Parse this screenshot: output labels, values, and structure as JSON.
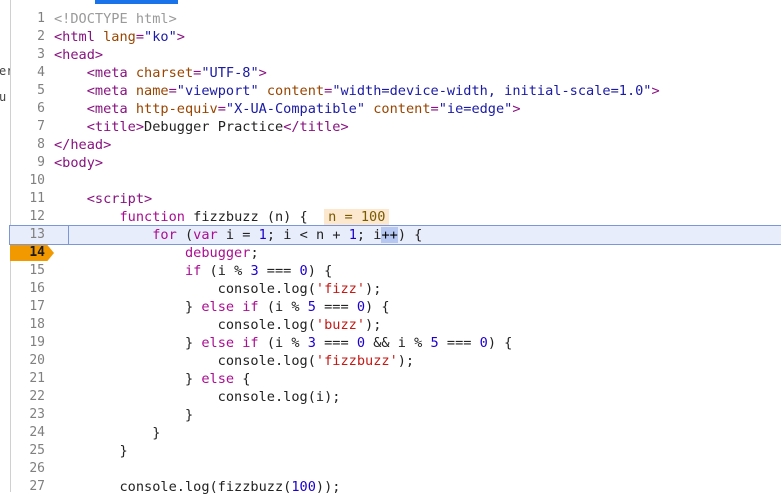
{
  "side_fragments": [
    "er",
    "u"
  ],
  "lines": [
    {
      "n": "1",
      "t": [
        {
          "c": "cmt",
          "v": "<!DOCTYPE html>"
        }
      ]
    },
    {
      "n": "2",
      "t": [
        {
          "c": "tag",
          "v": "<html "
        },
        {
          "c": "attr",
          "v": "lang"
        },
        {
          "c": "tag",
          "v": "="
        },
        {
          "c": "val",
          "v": "\"ko\""
        },
        {
          "c": "tag",
          "v": ">"
        }
      ]
    },
    {
      "n": "3",
      "t": [
        {
          "c": "tag",
          "v": "<head>"
        }
      ]
    },
    {
      "n": "4",
      "t": [
        {
          "c": "txt",
          "v": "    "
        },
        {
          "c": "tag",
          "v": "<meta "
        },
        {
          "c": "attr",
          "v": "charset"
        },
        {
          "c": "tag",
          "v": "="
        },
        {
          "c": "val",
          "v": "\"UTF-8\""
        },
        {
          "c": "tag",
          "v": ">"
        }
      ]
    },
    {
      "n": "5",
      "t": [
        {
          "c": "txt",
          "v": "    "
        },
        {
          "c": "tag",
          "v": "<meta "
        },
        {
          "c": "attr",
          "v": "name"
        },
        {
          "c": "tag",
          "v": "="
        },
        {
          "c": "val",
          "v": "\"viewport\""
        },
        {
          "c": "attr",
          "v": " content"
        },
        {
          "c": "tag",
          "v": "="
        },
        {
          "c": "val",
          "v": "\"width=device-width, initial-scale=1.0\""
        },
        {
          "c": "tag",
          "v": ">"
        }
      ]
    },
    {
      "n": "6",
      "t": [
        {
          "c": "txt",
          "v": "    "
        },
        {
          "c": "tag",
          "v": "<meta "
        },
        {
          "c": "attr",
          "v": "http-equiv"
        },
        {
          "c": "tag",
          "v": "="
        },
        {
          "c": "val",
          "v": "\"X-UA-Compatible\""
        },
        {
          "c": "attr",
          "v": " content"
        },
        {
          "c": "tag",
          "v": "="
        },
        {
          "c": "val",
          "v": "\"ie=edge\""
        },
        {
          "c": "tag",
          "v": ">"
        }
      ]
    },
    {
      "n": "7",
      "t": [
        {
          "c": "txt",
          "v": "    "
        },
        {
          "c": "tag",
          "v": "<title>"
        },
        {
          "c": "txt",
          "v": "Debugger Practice"
        },
        {
          "c": "tag",
          "v": "</title>"
        }
      ]
    },
    {
      "n": "8",
      "t": [
        {
          "c": "tag",
          "v": "</head>"
        }
      ]
    },
    {
      "n": "9",
      "t": [
        {
          "c": "tag",
          "v": "<body>"
        }
      ]
    },
    {
      "n": "10",
      "t": []
    },
    {
      "n": "11",
      "t": [
        {
          "c": "txt",
          "v": "    "
        },
        {
          "c": "tag",
          "v": "<script>"
        }
      ]
    },
    {
      "n": "12",
      "t": [
        {
          "c": "txt",
          "v": "        "
        },
        {
          "c": "kw",
          "v": "function "
        },
        {
          "c": "txt",
          "v": "fizzbuzz (n) {  "
        },
        {
          "c": "inline-val",
          "v": "n = 100"
        }
      ]
    },
    {
      "n": "13",
      "hl": true,
      "t": [
        {
          "c": "txt",
          "v": "            "
        },
        {
          "c": "kw",
          "v": "for "
        },
        {
          "c": "txt",
          "v": "("
        },
        {
          "c": "kw",
          "v": "var "
        },
        {
          "c": "txt",
          "v": "i = "
        },
        {
          "c": "num",
          "v": "1"
        },
        {
          "c": "txt",
          "v": "; i < n + "
        },
        {
          "c": "num",
          "v": "1"
        },
        {
          "c": "txt",
          "v": "; i"
        },
        {
          "c": "sel",
          "v": "++"
        },
        {
          "c": "txt",
          "v": ") {"
        }
      ]
    },
    {
      "n": "14",
      "paused": true,
      "t": [
        {
          "c": "txt",
          "v": "                "
        },
        {
          "c": "kw",
          "v": "debugger"
        },
        {
          "c": "txt",
          "v": ";"
        }
      ]
    },
    {
      "n": "15",
      "t": [
        {
          "c": "txt",
          "v": "                "
        },
        {
          "c": "kw",
          "v": "if "
        },
        {
          "c": "txt",
          "v": "(i % "
        },
        {
          "c": "num",
          "v": "3"
        },
        {
          "c": "txt",
          "v": " === "
        },
        {
          "c": "num",
          "v": "0"
        },
        {
          "c": "txt",
          "v": ") {"
        }
      ]
    },
    {
      "n": "16",
      "t": [
        {
          "c": "txt",
          "v": "                    console.log("
        },
        {
          "c": "str",
          "v": "'fizz'"
        },
        {
          "c": "txt",
          "v": ");"
        }
      ]
    },
    {
      "n": "17",
      "t": [
        {
          "c": "txt",
          "v": "                } "
        },
        {
          "c": "kw",
          "v": "else if "
        },
        {
          "c": "txt",
          "v": "(i % "
        },
        {
          "c": "num",
          "v": "5"
        },
        {
          "c": "txt",
          "v": " === "
        },
        {
          "c": "num",
          "v": "0"
        },
        {
          "c": "txt",
          "v": ") {"
        }
      ]
    },
    {
      "n": "18",
      "t": [
        {
          "c": "txt",
          "v": "                    console.log("
        },
        {
          "c": "str",
          "v": "'buzz'"
        },
        {
          "c": "txt",
          "v": ");"
        }
      ]
    },
    {
      "n": "19",
      "t": [
        {
          "c": "txt",
          "v": "                } "
        },
        {
          "c": "kw",
          "v": "else if "
        },
        {
          "c": "txt",
          "v": "(i % "
        },
        {
          "c": "num",
          "v": "3"
        },
        {
          "c": "txt",
          "v": " === "
        },
        {
          "c": "num",
          "v": "0"
        },
        {
          "c": "txt",
          "v": " && i % "
        },
        {
          "c": "num",
          "v": "5"
        },
        {
          "c": "txt",
          "v": " === "
        },
        {
          "c": "num",
          "v": "0"
        },
        {
          "c": "txt",
          "v": ") {"
        }
      ]
    },
    {
      "n": "20",
      "t": [
        {
          "c": "txt",
          "v": "                    console.log("
        },
        {
          "c": "str",
          "v": "'fizzbuzz'"
        },
        {
          "c": "txt",
          "v": ");"
        }
      ]
    },
    {
      "n": "21",
      "t": [
        {
          "c": "txt",
          "v": "                } "
        },
        {
          "c": "kw",
          "v": "else "
        },
        {
          "c": "txt",
          "v": "{"
        }
      ]
    },
    {
      "n": "22",
      "t": [
        {
          "c": "txt",
          "v": "                    console.log(i);"
        }
      ]
    },
    {
      "n": "23",
      "t": [
        {
          "c": "txt",
          "v": "                }"
        }
      ]
    },
    {
      "n": "24",
      "t": [
        {
          "c": "txt",
          "v": "            }"
        }
      ]
    },
    {
      "n": "25",
      "t": [
        {
          "c": "txt",
          "v": "        }"
        }
      ]
    },
    {
      "n": "26",
      "t": []
    },
    {
      "n": "27",
      "t": [
        {
          "c": "txt",
          "v": "        console.log(fizzbuzz("
        },
        {
          "c": "num",
          "v": "100"
        },
        {
          "c": "txt",
          "v": "));"
        }
      ]
    }
  ]
}
